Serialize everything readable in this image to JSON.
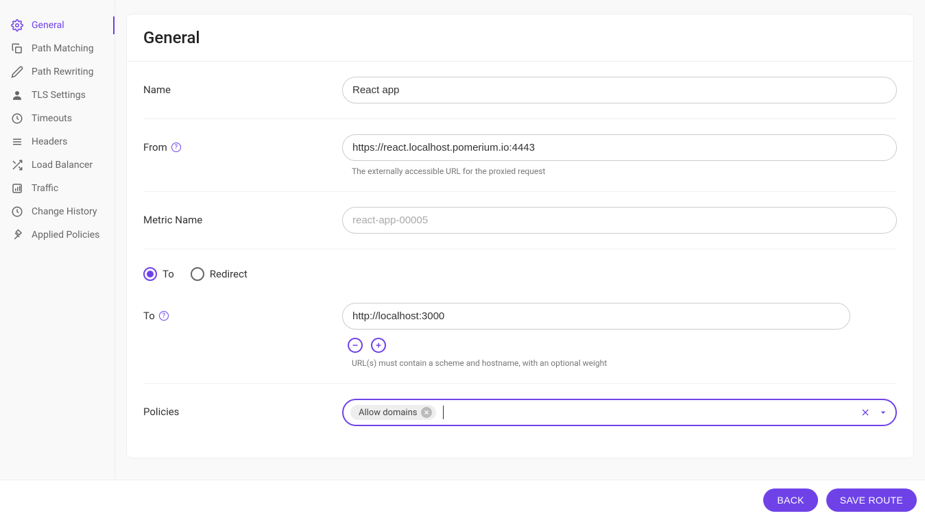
{
  "sidebar": {
    "items": [
      {
        "label": "General",
        "icon": "gear",
        "active": true
      },
      {
        "label": "Path Matching",
        "icon": "copy",
        "active": false
      },
      {
        "label": "Path Rewriting",
        "icon": "pencil",
        "active": false
      },
      {
        "label": "TLS Settings",
        "icon": "person",
        "active": false
      },
      {
        "label": "Timeouts",
        "icon": "clock",
        "active": false
      },
      {
        "label": "Headers",
        "icon": "lines",
        "active": false
      },
      {
        "label": "Load Balancer",
        "icon": "shuffle",
        "active": false
      },
      {
        "label": "Traffic",
        "icon": "chart",
        "active": false
      },
      {
        "label": "Change History",
        "icon": "clock",
        "active": false
      },
      {
        "label": "Applied Policies",
        "icon": "gavel",
        "active": false
      }
    ]
  },
  "page": {
    "title": "General"
  },
  "form": {
    "name_label": "Name",
    "name_value": "React app",
    "from_label": "From",
    "from_value": "https://react.localhost.pomerium.io:4443",
    "from_help": "The externally accessible URL for the proxied request",
    "metric_label": "Metric Name",
    "metric_placeholder": "react-app-00005",
    "radio_to": "To",
    "radio_redirect": "Redirect",
    "radio_selected": "to",
    "to_label": "To",
    "to_value": "http://localhost:3000",
    "to_help": "URL(s) must contain a scheme and hostname, with an optional weight",
    "policies_label": "Policies",
    "policies_chips": [
      "Allow domains"
    ]
  },
  "footer": {
    "back": "BACK",
    "save": "SAVE ROUTE"
  }
}
